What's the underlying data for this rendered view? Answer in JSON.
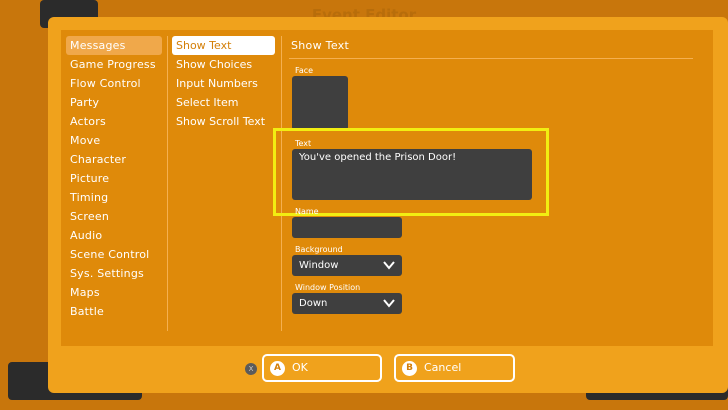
{
  "background": {
    "title": "Event Editor"
  },
  "categories": [
    {
      "label": "Messages",
      "active": true
    },
    {
      "label": "Game Progress"
    },
    {
      "label": "Flow Control"
    },
    {
      "label": "Party"
    },
    {
      "label": "Actors"
    },
    {
      "label": "Move"
    },
    {
      "label": "Character"
    },
    {
      "label": "Picture"
    },
    {
      "label": "Timing"
    },
    {
      "label": "Screen"
    },
    {
      "label": "Audio"
    },
    {
      "label": "Scene Control"
    },
    {
      "label": "Sys. Settings"
    },
    {
      "label": "Maps"
    },
    {
      "label": "Battle"
    }
  ],
  "subcommands": [
    {
      "label": "Show Text",
      "active": true
    },
    {
      "label": "Show Choices"
    },
    {
      "label": "Input Numbers"
    },
    {
      "label": "Select Item"
    },
    {
      "label": "Show Scroll Text"
    }
  ],
  "form": {
    "section_title": "Show Text",
    "face_label": "Face",
    "text_label": "Text",
    "text_value": "You've opened the Prison Door!",
    "name_label": "Name",
    "name_value": "",
    "background_label": "Background",
    "background_value": "Window",
    "window_position_label": "Window Position",
    "window_position_value": "Down"
  },
  "footer": {
    "x_glyph": "X",
    "ok_glyph": "A",
    "ok_label": "OK",
    "cancel_glyph": "B",
    "cancel_label": "Cancel"
  },
  "colors": {
    "dialog": "#f0a21c",
    "panel": "#df8a0a",
    "field": "#3f3f3f",
    "highlight": "#f2ee12"
  }
}
